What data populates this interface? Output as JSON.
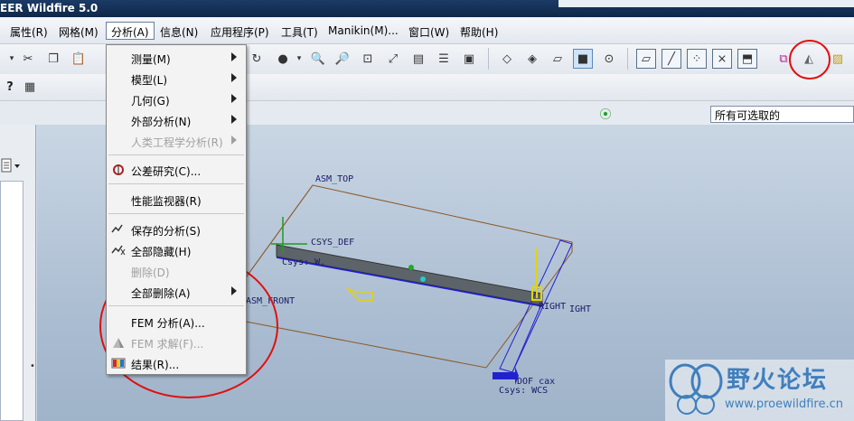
{
  "window": {
    "title": "EER Wildfire 5.0"
  },
  "menubar": [
    {
      "label": "属性(R)"
    },
    {
      "label": "网格(M)"
    },
    {
      "label": "分析(A)"
    },
    {
      "label": "信息(N)"
    },
    {
      "label": "应用程序(P)"
    },
    {
      "label": "工具(T)"
    },
    {
      "label": "Manikin(M)..."
    },
    {
      "label": "窗口(W)"
    },
    {
      "label": "帮助(H)"
    }
  ],
  "toolbar": {
    "help_icon_text": "?",
    "icons": [
      "cut-icon",
      "copy-icon",
      "paste-icon",
      "shading-icon",
      "zoom-in-icon",
      "zoom-out-icon",
      "refit-icon",
      "orient-icon",
      "saved-views-icon",
      "layers-icon",
      "model-setup-icon",
      "wireframe-icon",
      "hidden-line-icon",
      "no-hidden-icon",
      "shading-view-icon",
      "spin-center-icon",
      "datum-plane-icon",
      "datum-axis-icon",
      "datum-point-icon",
      "csys-icon",
      "annotation-icon",
      "fem-solve-icon"
    ]
  },
  "filter": {
    "value": "所有可选取的"
  },
  "analysis_menu": {
    "items": [
      {
        "label": "测量(M)",
        "submenu": true,
        "disabled": false
      },
      {
        "label": "模型(L)",
        "submenu": true,
        "disabled": false
      },
      {
        "label": "几何(G)",
        "submenu": true,
        "disabled": false
      },
      {
        "label": "外部分析(N)",
        "submenu": true,
        "disabled": false
      },
      {
        "label": "人类工程学分析(R)",
        "submenu": true,
        "disabled": true
      },
      {
        "label": "公差研究(C)...",
        "submenu": false,
        "disabled": false,
        "icon": "tolerance-icon"
      },
      {
        "label": "性能监视器(R)",
        "submenu": false,
        "disabled": false
      },
      {
        "label": "保存的分析(S)",
        "submenu": false,
        "disabled": false,
        "icon": "saved-analysis-icon"
      },
      {
        "label": "全部隐藏(H)",
        "submenu": false,
        "disabled": false,
        "icon": "hide-all-icon"
      },
      {
        "label": "删除(D)",
        "submenu": false,
        "disabled": true
      },
      {
        "label": "全部删除(A)",
        "submenu": true,
        "disabled": false
      },
      {
        "label": "FEM 分析(A)...",
        "submenu": false,
        "disabled": false
      },
      {
        "label": "FEM 求解(F)...",
        "submenu": false,
        "disabled": true,
        "icon": "fem-solve-icon"
      },
      {
        "label": "结果(R)...",
        "submenu": false,
        "disabled": false,
        "icon": "results-icon"
      }
    ]
  },
  "scene_labels": {
    "asm_top": "ASM_TOP",
    "asm_front": "ASM_FRONT",
    "csys_def": "CSYS_DEF",
    "csys_top_left": "Csys: W.",
    "right": "RIGHT",
    "right2": "IGHT",
    "dof_label": "DOF cax",
    "dof_csys": "Csys: WCS"
  },
  "watermark": {
    "title": "野火论坛",
    "url": "www.proewildfire.cn"
  },
  "colors": {
    "title_bar": "#10294d",
    "annotation_circle": "#e01010",
    "dof_blue": "#2222cc"
  }
}
